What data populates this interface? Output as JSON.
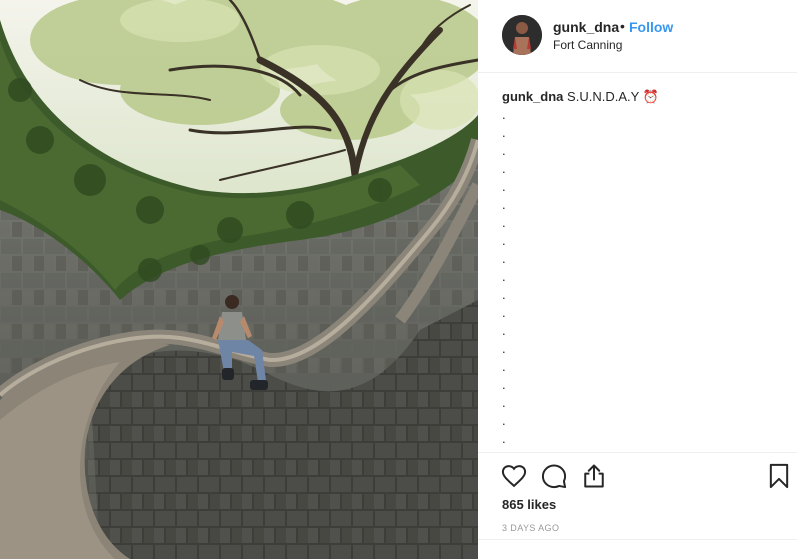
{
  "post": {
    "image_alt": "Man sitting on a curved stone staircase wall inside a tree-covered tunnel"
  },
  "header": {
    "username": "gunk_dna",
    "separator": "•",
    "follow_label": "Follow",
    "location": "Fort Canning"
  },
  "caption": {
    "username": "gunk_dna",
    "text": "S.U.N.D.A.Y",
    "emoji": "⏰",
    "dot_lines": [
      ".",
      ".",
      ".",
      ".",
      ".",
      ".",
      ".",
      ".",
      ".",
      ".",
      ".",
      ".",
      ".",
      ".",
      ".",
      ".",
      ".",
      ".",
      "."
    ]
  },
  "actions": {
    "like_icon": "heart-icon",
    "comment_icon": "comment-icon",
    "share_icon": "share-icon",
    "save_icon": "bookmark-icon",
    "likes": "865 likes",
    "time_ago": "3 DAYS AGO"
  },
  "colors": {
    "link": "#3897f0",
    "text": "#262626",
    "muted": "#999999",
    "divider": "#efefef"
  }
}
